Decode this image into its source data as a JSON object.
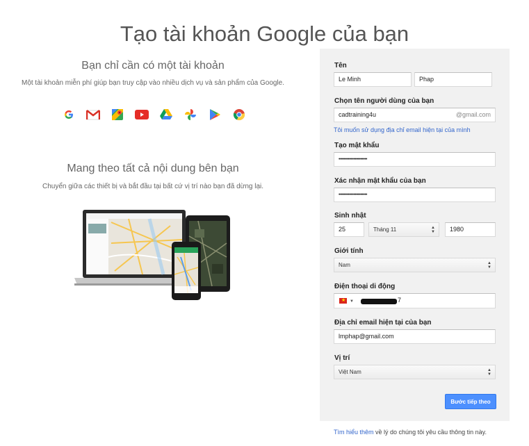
{
  "page_title": "Tạo tài khoản Google của bạn",
  "left": {
    "heading1": "Bạn chỉ cần có một tài khoản",
    "text1": "Một tài khoản miễn phí giúp bạn truy cập vào nhiều dịch vụ và sản phẩm của Google.",
    "icons": [
      "google-g-icon",
      "gmail-icon",
      "maps-icon",
      "youtube-icon",
      "drive-icon",
      "photos-icon",
      "play-store-icon",
      "chrome-icon"
    ],
    "heading2": "Mang theo tất cả nội dung bên bạn",
    "text2": "Chuyển giữa các thiết bị và bắt đầu tại bất cứ vị trí nào bạn đã dừng lại."
  },
  "form": {
    "name_label": "Tên",
    "first_name": "Le Minh",
    "last_name": "Phap",
    "username_label": "Chọn tên người dùng của bạn",
    "username": "cadtraining4u",
    "domain_suffix": "@gmail.com",
    "use_existing_email_link": "Tôi muốn sử dụng địa chỉ email hiện tại của mình",
    "password_label": "Tạo mật khẩu",
    "password": "•••••••••••••••••••••",
    "confirm_label": "Xác nhận mật khẩu của bạn",
    "confirm_password": "•••••••••••••••••••••",
    "birthday_label": "Sinh nhật",
    "birth_day": "25",
    "birth_month": "Tháng 11",
    "birth_year": "1980",
    "gender_label": "Giới tính",
    "gender": "Nam",
    "phone_label": "Điện thoại di động",
    "phone_tail": "7",
    "current_email_label": "Địa chỉ email hiện tại của bạn",
    "current_email": "lmphap@gmail.com",
    "location_label": "Vị trí",
    "location": "Việt Nam",
    "next_button": "Bước tiếp theo"
  },
  "footer": {
    "link": "Tìm hiểu thêm",
    "text": " về lý do chúng tôi yêu cầu thông tin này."
  },
  "colors": {
    "accent": "#4d90fe",
    "link": "#3366cc",
    "panel": "#f1f1f1"
  }
}
